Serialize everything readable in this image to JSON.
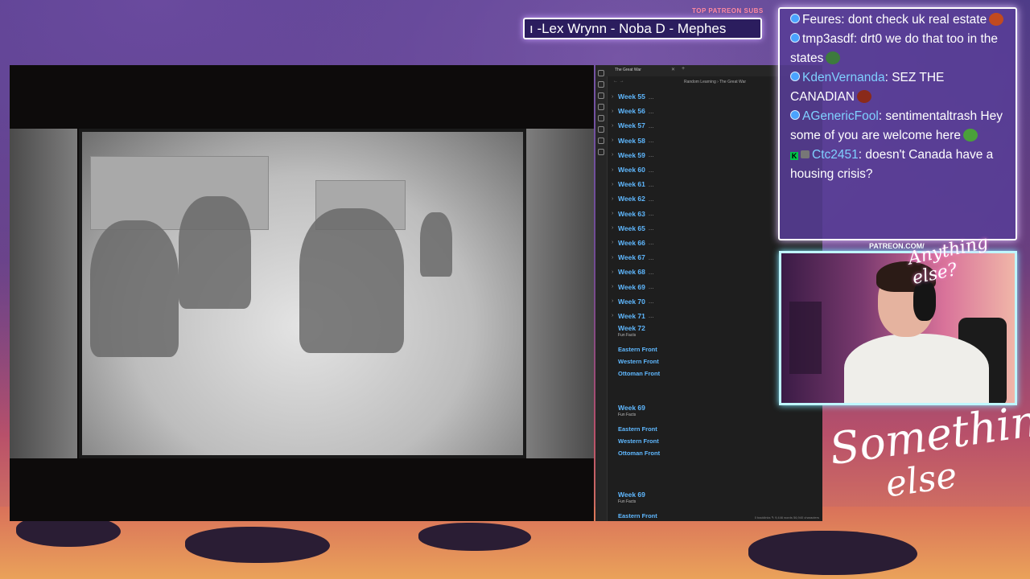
{
  "subs": {
    "label": "TOP PATREON SUBS",
    "ticker": "ı -Lex Wrynn -  Noba D - Mephes"
  },
  "chat": [
    {
      "user": "Feures",
      "user_color": "#ffffff",
      "text": "dont check uk real estate",
      "emote": "#c24a1f"
    },
    {
      "user": "tmp3asdf",
      "user_color": "#ffffff",
      "text": "drt0 we do that too in the states",
      "emote": "#3d7a3d"
    },
    {
      "user": "KdenVernanda",
      "user_color": "#7fd0ff",
      "text": "SEZ THE CANADIAN",
      "emote": "#8a2a1a"
    },
    {
      "user": "AGenericFool",
      "user_color": "#7fd0ff",
      "text": "sentimentaltrash Hey some of you are welcome here",
      "emote": "#4aa03a"
    },
    {
      "user": "Ctc2451",
      "user_color": "#7fd0ff",
      "text": "doesn't Canada have a housing crisis?",
      "emote": ""
    }
  ],
  "obsidian": {
    "tab": "The Great War",
    "breadcrumb": "Random Learning  ›  The Great War",
    "weeks": [
      "Week 55",
      "Week 56",
      "Week 57",
      "Week 58",
      "Week 59",
      "Week 60",
      "Week 61",
      "Week 62",
      "Week 63",
      "Week 65",
      "Week 66",
      "Week 67",
      "Week 68",
      "Week 69",
      "Week 70",
      "Week 71"
    ],
    "ellipsis": "...",
    "sections": [
      {
        "title": "Week 72",
        "sub": "Fun Facts",
        "fronts": [
          "Eastern Front",
          "Western Front",
          "Ottoman Front"
        ]
      },
      {
        "title": "Week 69",
        "sub": "Fun Facts",
        "fronts": [
          "Eastern Front",
          "Western Front",
          "Ottoman Front"
        ]
      },
      {
        "title": "Week 69",
        "sub": "Fun Facts",
        "fronts": [
          "Eastern Front"
        ]
      }
    ],
    "status": "0 backlinks   ✎   9,446 words   56,940 characters"
  },
  "webcam": {
    "patreon_url": "PATREON.COM/",
    "overlay_script": "Anything else?"
  },
  "brand": {
    "line1": "Something",
    "line2": "else"
  }
}
